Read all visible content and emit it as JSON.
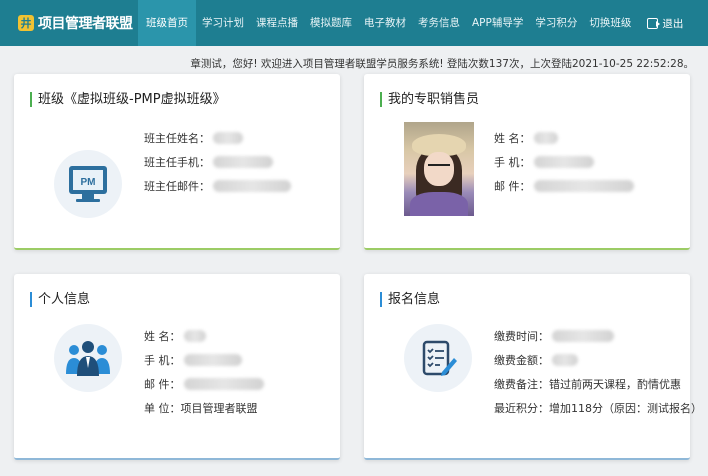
{
  "header": {
    "logo_text": "项目管理者联盟",
    "nav": [
      {
        "label": "班级首页",
        "active": true
      },
      {
        "label": "学习计划"
      },
      {
        "label": "课程点播"
      },
      {
        "label": "模拟题库"
      },
      {
        "label": "电子教材"
      },
      {
        "label": "考务信息"
      },
      {
        "label": "APP辅导学"
      },
      {
        "label": "学习积分"
      },
      {
        "label": "切换班级"
      }
    ],
    "logout_label": "退出"
  },
  "welcome_text": "章测试，您好! 欢迎进入项目管理者联盟学员服务系统! 登陆次数137次，上次登陆2021-10-25 22:52:28。",
  "class_card": {
    "title": "班级《虚拟班级-PMP虚拟班级》",
    "icon_text": "PM",
    "rows": [
      {
        "label": "班主任姓名："
      },
      {
        "label": "班主任手机："
      },
      {
        "label": "班主任邮件："
      }
    ]
  },
  "sales_card": {
    "title": "我的专职销售员",
    "rows": [
      {
        "label": "姓 名："
      },
      {
        "label": "手 机："
      },
      {
        "label": "邮 件："
      }
    ]
  },
  "personal_card": {
    "title": "个人信息",
    "rows": [
      {
        "label": "姓 名："
      },
      {
        "label": "手 机："
      },
      {
        "label": "邮 件："
      },
      {
        "label": "单 位：",
        "value": "项目管理者联盟"
      }
    ]
  },
  "signup_card": {
    "title": "报名信息",
    "rows": [
      {
        "label": "缴费时间："
      },
      {
        "label": "缴费金额："
      },
      {
        "label": "缴费备注：",
        "value": "错过前两天课程，酌情优惠"
      },
      {
        "label": "最近积分：",
        "value": "增加118分（原因：测试报名）"
      }
    ]
  },
  "colors": {
    "header_bg": "#1e7e91",
    "nav_active_bg": "#2b95ab",
    "logo_accent": "#f1c232",
    "green_accent": "#4caf50",
    "blue_accent": "#2b8dd6"
  }
}
